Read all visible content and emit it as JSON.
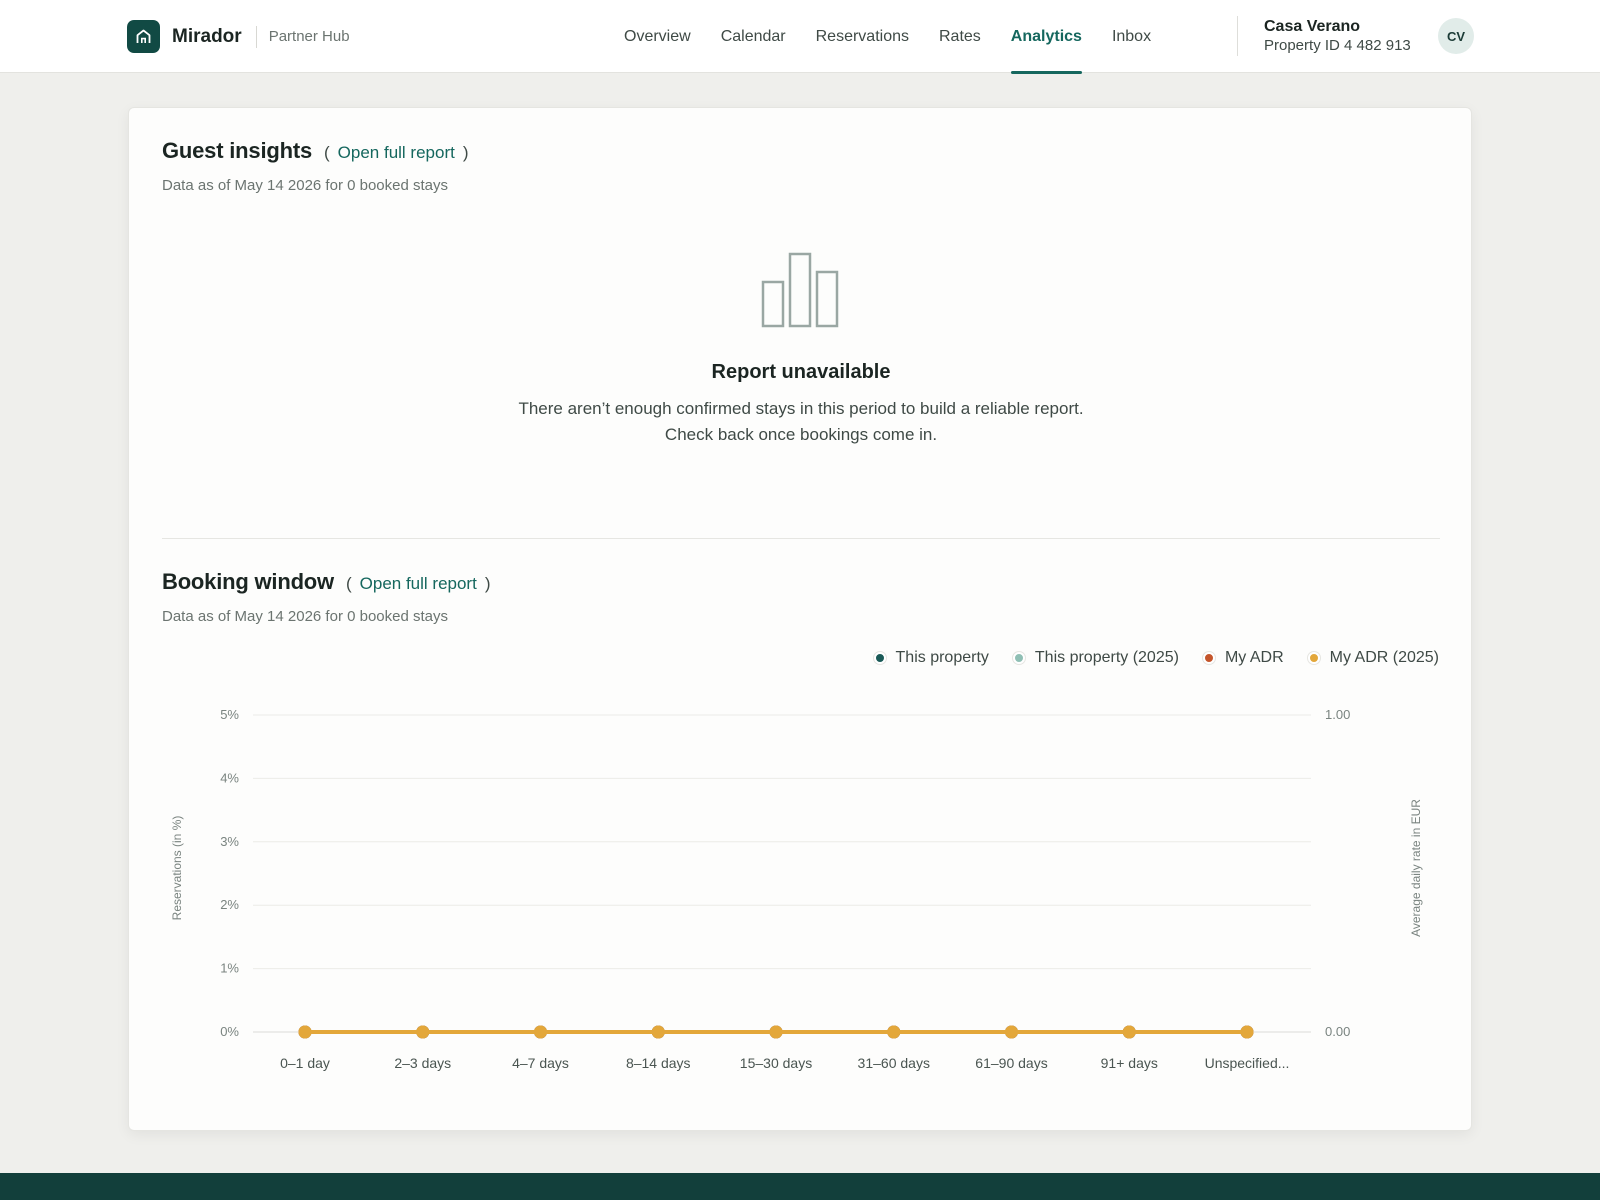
{
  "brand": {
    "name": "Mirador",
    "sub": "Partner Hub"
  },
  "nav": [
    {
      "label": "Overview",
      "active": false
    },
    {
      "label": "Calendar",
      "active": false
    },
    {
      "label": "Reservations",
      "active": false
    },
    {
      "label": "Rates",
      "active": false
    },
    {
      "label": "Analytics",
      "active": true
    },
    {
      "label": "Inbox",
      "active": false
    }
  ],
  "account": {
    "name": "Casa Verano",
    "property_id": "Property ID 4 482 913",
    "initials": "CV"
  },
  "guest_insights": {
    "title": "Guest insights",
    "paren_open": "(",
    "link": "Open full report",
    "paren_close": ")",
    "subtitle": "Data as of May 14 2026 for 0 booked stays",
    "empty_icon": "bar-chart-icon",
    "empty_title": "Report unavailable",
    "empty_text": "There aren’t enough confirmed stays in this period to build a reliable report. Check back once bookings come in."
  },
  "booking_window": {
    "title": "Booking window",
    "paren_open": "(",
    "link": "Open full report",
    "paren_close": ")",
    "subtitle": "Data as of May 14 2026 for 0 booked stays"
  },
  "colors": {
    "accent": "#15675e",
    "this_property": "#1a5a57",
    "this_property_2025": "#8fbfb4",
    "my_adr": "#c4552b",
    "my_adr_2025": "#e3a73a"
  },
  "chart_data": {
    "type": "line",
    "categories": [
      "0–1 day",
      "2–3 days",
      "4–7 days",
      "8–14 days",
      "15–30 days",
      "31–60 days",
      "61–90 days",
      "91+ days",
      "Unspecified..."
    ],
    "series": [
      {
        "name": "This property",
        "color": "#1a5a57",
        "axis": "left",
        "values": [
          0,
          0,
          0,
          0,
          0,
          0,
          0,
          0,
          0
        ]
      },
      {
        "name": "This property (2025)",
        "color": "#8fbfb4",
        "axis": "left",
        "values": [
          0,
          0,
          0,
          0,
          0,
          0,
          0,
          0,
          0
        ]
      },
      {
        "name": "My ADR",
        "color": "#c4552b",
        "axis": "right",
        "values": [
          0,
          0,
          0,
          0,
          0,
          0,
          0,
          0,
          0
        ]
      },
      {
        "name": "My ADR (2025)",
        "color": "#e3a73a",
        "axis": "right",
        "values": [
          0,
          0,
          0,
          0,
          0,
          0,
          0,
          0,
          0
        ]
      }
    ],
    "ylabel": "Reservations (in %)",
    "y2label": "Average daily rate in EUR",
    "ylim": [
      0,
      5
    ],
    "y2lim": [
      0,
      1
    ],
    "yticks": [
      "0%",
      "1%",
      "2%",
      "3%",
      "4%",
      "5%"
    ],
    "y2ticks": [
      "0.00",
      "1.00"
    ],
    "grid": true,
    "legend": "top-right"
  }
}
